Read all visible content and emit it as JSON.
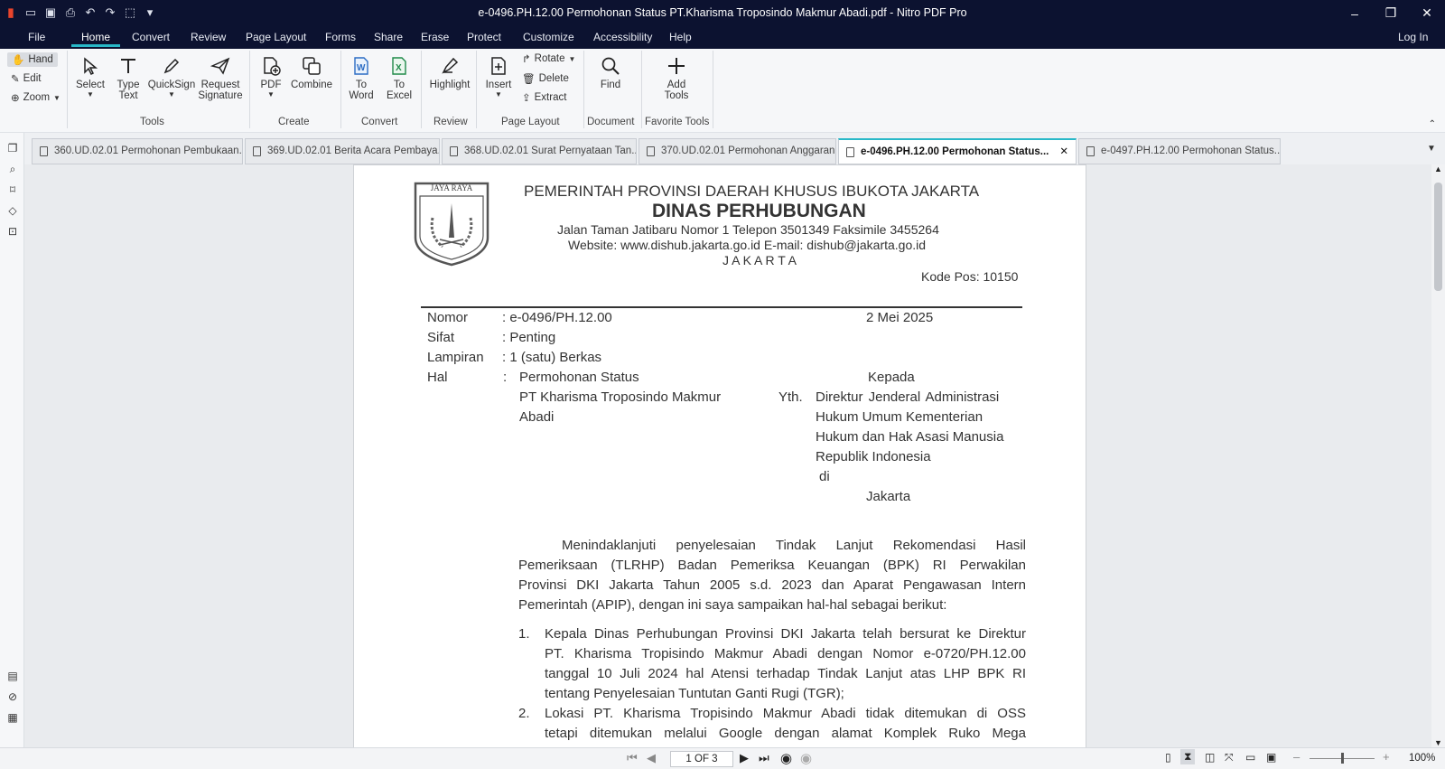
{
  "app": {
    "title": "e-0496.PH.12.00 Permohonan Status PT.Kharisma Troposindo Makmur Abadi.pdf - Nitro PDF Pro",
    "login": "Log In"
  },
  "menu": [
    "File",
    "Home",
    "Convert",
    "Review",
    "Page Layout",
    "Forms",
    "Share",
    "Erase",
    "Protect",
    "Customize",
    "Accessibility",
    "Help"
  ],
  "ribbon": {
    "hand": "Hand",
    "edit": "Edit",
    "zoom": "Zoom",
    "select": "Select",
    "type_text_1": "Type",
    "type_text_2": "Text",
    "quicksign": "QuickSign",
    "request_1": "Request",
    "request_2": "Signature",
    "tools_group": "Tools",
    "pdf": "PDF",
    "combine": "Combine",
    "create_group": "Create",
    "to_word_1": "To",
    "to_word_2": "Word",
    "to_excel_1": "To",
    "to_excel_2": "Excel",
    "convert_group": "Convert",
    "highlight": "Highlight",
    "review_group": "Review",
    "insert": "Insert",
    "rotate": "Rotate",
    "delete": "Delete",
    "extract": "Extract",
    "page_layout_group": "Page Layout",
    "find": "Find",
    "document_group": "Document",
    "add_tools_1": "Add",
    "add_tools_2": "Tools",
    "favorite_group": "Favorite Tools"
  },
  "tabs": [
    {
      "label": "360.UD.02.01 Permohonan Pembukaan..."
    },
    {
      "label": "369.UD.02.01 Berita Acara Pembaya..."
    },
    {
      "label": "368.UD.02.01 Surat Pernyataan Tan..."
    },
    {
      "label": "370.UD.02.01 Permohonan Anggaran"
    },
    {
      "label": "e-0496.PH.12.00 Permohonan Status..."
    },
    {
      "label": "e-0497.PH.12.00 Permohonan Status..."
    }
  ],
  "doc": {
    "logo_text": "JAYA RAYA",
    "header1": "PEMERINTAH PROVINSI DAERAH KHUSUS IBUKOTA JAKARTA",
    "header2": "DINAS PERHUBUNGAN",
    "header3": "Jalan Taman Jatibaru Nomor 1 Telepon 3501349  Faksimile 3455264",
    "header4": "Website: www.dishub.jakarta.go.id   E-mail: dishub@jakarta.go.id",
    "header5": "J A K A R T A",
    "kodepos": "Kode Pos: 10150",
    "nomor_label": "Nomor",
    "nomor_value": ":  e-0496/PH.12.00",
    "date": "2 Mei 2025",
    "sifat_label": "Sifat",
    "sifat_value": ":  Penting",
    "lampiran_label": "Lampiran",
    "lampiran_value": ":  1 (satu) Berkas",
    "hal_label": "Hal",
    "hal_colon": ":",
    "hal_1": "Permohonan Status",
    "hal_2": "PT Kharisma Troposindo Makmur",
    "hal_3": "Abadi",
    "kepada": "Kepada",
    "yth": "Yth.",
    "addr1": "Direktur   Jenderal   Administrasi",
    "addr2": "Hukum   Umum   Kementerian",
    "addr3": "Hukum dan Hak Asasi Manusia",
    "addr4": "Republik Indonesia",
    "addr5": "di",
    "addr6": "Jakarta",
    "p1_l1": "Menindaklanjuti penyelesaian Tindak Lanjut Rekomendasi Hasil",
    "p1_l2": "Pemeriksaan (TLRHP) Badan Pemeriksa Keuangan (BPK) RI Perwakilan",
    "p1_l3": "Provinsi DKI Jakarta Tahun 2005 s.d. 2023 dan Aparat Pengawasan Intern",
    "p1_l4": "Pemerintah (APIP), dengan ini saya sampaikan hal-hal sebagai berikut:",
    "n1": "1.",
    "i1_l1": "Kepala Dinas Perhubungan Provinsi DKI Jakarta telah bersurat ke Direktur",
    "i1_l2": "PT. Kharisma Tropisindo Makmur Abadi dengan Nomor e-0720/PH.12.00",
    "i1_l3": "tanggal 10 Juli 2024 hal Atensi terhadap Tindak Lanjut atas LHP BPK RI",
    "i1_l4": "tentang Penyelesaian Tuntutan Ganti Rugi (TGR);",
    "n2": "2.",
    "i2_l1": "Lokasi PT. Kharisma Tropisindo Makmur Abadi tidak ditemukan di OSS",
    "i2_l2": "tetapi ditemukan melalui Google dengan alamat Komplek Ruko Mega"
  },
  "status": {
    "page": "1 OF 3",
    "zoom": "100%"
  },
  "colors": {
    "titlebar": "#0c1230",
    "accent": "#28b8c8",
    "nitro_logo": "#e8442c"
  }
}
